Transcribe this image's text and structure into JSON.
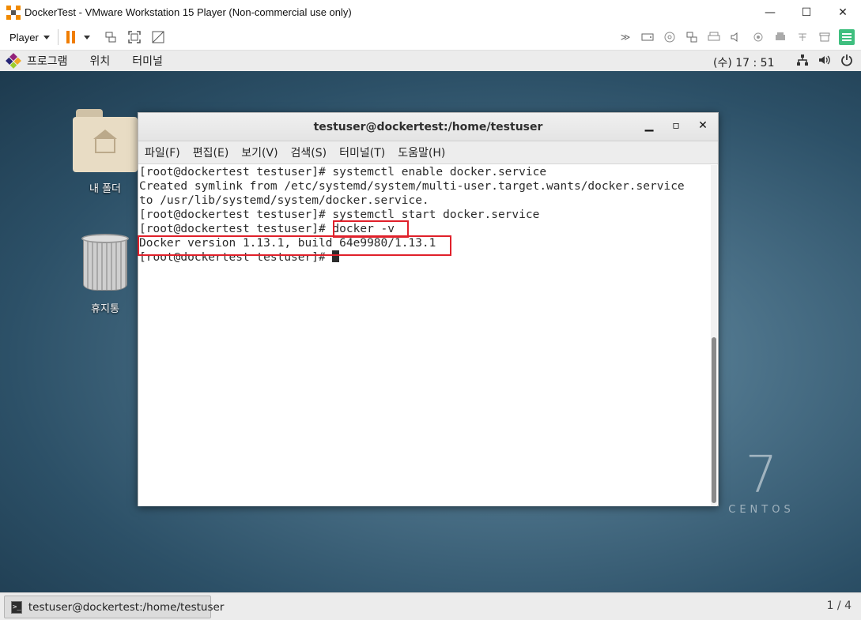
{
  "vmware": {
    "title": "DockerTest - VMware Workstation 15 Player (Non-commercial use only)",
    "controls": {
      "minimize": "—",
      "maximize": "☐",
      "close": "✕"
    },
    "toolbar": {
      "player_label": "Player"
    }
  },
  "gnome_panel": {
    "applications": "프로그램",
    "places": "위치",
    "terminal": "터미널",
    "clock": "(수) 17 : 51"
  },
  "desktop": {
    "icons": [
      {
        "label": "내 폴더"
      },
      {
        "label": "휴지통"
      }
    ],
    "branding": {
      "number": "7",
      "word": "CENTOS"
    }
  },
  "terminal": {
    "title": "testuser@dockertest:/home/testuser",
    "menu": [
      "파일(F)",
      "편집(E)",
      "보기(V)",
      "검색(S)",
      "터미널(T)",
      "도움말(H)"
    ],
    "lines": [
      "[root@dockertest testuser]# systemctl enable docker.service",
      "Created symlink from /etc/systemd/system/multi-user.target.wants/docker.service",
      "to /usr/lib/systemd/system/docker.service.",
      "[root@dockertest testuser]# systemctl start docker.service",
      "[root@dockertest testuser]# docker -v",
      "Docker version 1.13.1, build 64e9980/1.13.1",
      "[root@dockertest testuser]# "
    ]
  },
  "taskbar": {
    "task_label": "testuser@dockertest:/home/testuser",
    "workspace": "1 / 4"
  },
  "colors": {
    "highlight": "#e0202a",
    "accent": "#f07d00"
  }
}
